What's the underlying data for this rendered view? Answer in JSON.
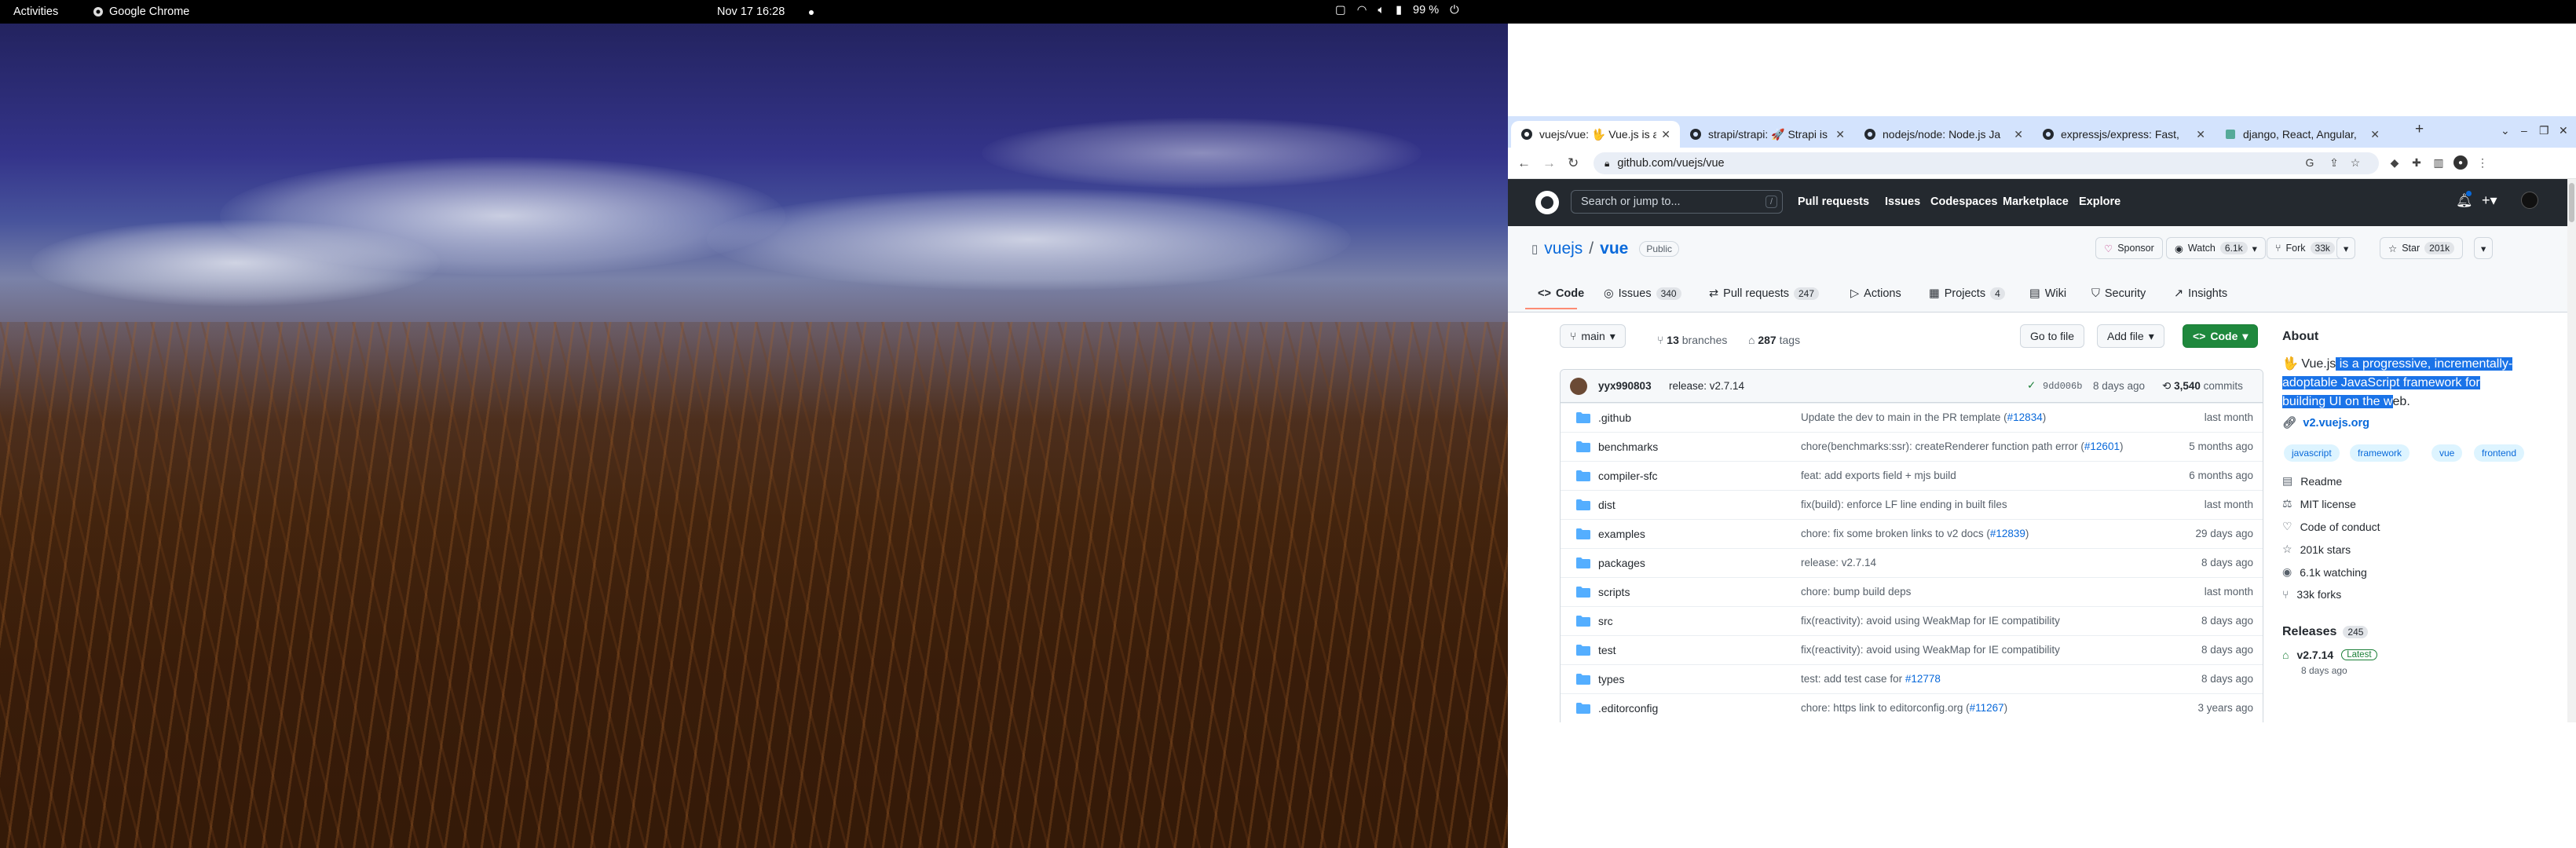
{
  "topbar": {
    "activities": "Activities",
    "app_name": "Google Chrome",
    "clock": "Nov 17  16:28",
    "battery": "99 %"
  },
  "browser": {
    "tabs": [
      {
        "title": "vuejs/vue: 🖖 Vue.js is a p"
      },
      {
        "title": "strapi/strapi: 🚀 Strapi is"
      },
      {
        "title": "nodejs/node: Node.js Ja"
      },
      {
        "title": "expressjs/express: Fast,"
      },
      {
        "title": "django, React, Angular,"
      }
    ],
    "url": "github.com/vuejs/vue"
  },
  "github": {
    "search_placeholder": "Search or jump to...",
    "search_key": "/",
    "nav": [
      "Pull requests",
      "Issues",
      "Codespaces",
      "Marketplace",
      "Explore"
    ],
    "repo": {
      "owner": "vuejs",
      "name": "vue",
      "visibility": "Public",
      "sponsor": "Sponsor",
      "watch_label": "Watch",
      "watch_count": "6.1k",
      "fork_label": "Fork",
      "fork_count": "33k",
      "star_label": "Star",
      "star_count": "201k"
    },
    "tabs": [
      {
        "label": "Code",
        "count": ""
      },
      {
        "label": "Issues",
        "count": "340"
      },
      {
        "label": "Pull requests",
        "count": "247"
      },
      {
        "label": "Actions",
        "count": ""
      },
      {
        "label": "Projects",
        "count": "4"
      },
      {
        "label": "Wiki",
        "count": ""
      },
      {
        "label": "Security",
        "count": ""
      },
      {
        "label": "Insights",
        "count": ""
      }
    ],
    "branch": "main",
    "branches_count": "13",
    "branches_label": "branches",
    "tags_count": "287",
    "tags_label": "tags",
    "go_to_file": "Go to file",
    "add_file": "Add file",
    "code_button": "Code",
    "latest_commit": {
      "author": "yyx990803",
      "message": "release: v2.7.14",
      "hash": "9dd006b",
      "age": "8 days ago",
      "commits_count": "3,540",
      "commits_label": "commits"
    },
    "files": [
      {
        "name": ".github",
        "msg": "Update the dev to main in the PR template (",
        "link": "#12834",
        "tail": ")",
        "age": "last month"
      },
      {
        "name": "benchmarks",
        "msg": "chore(benchmarks:ssr): createRenderer function path error (",
        "link": "#12601",
        "tail": ")",
        "age": "5 months ago"
      },
      {
        "name": "compiler-sfc",
        "msg": "feat: add exports field + mjs build",
        "link": "",
        "tail": "",
        "age": "6 months ago"
      },
      {
        "name": "dist",
        "msg": "fix(build): enforce LF line ending in built files",
        "link": "",
        "tail": "",
        "age": "last month"
      },
      {
        "name": "examples",
        "msg": "chore: fix some broken links to v2 docs (",
        "link": "#12839",
        "tail": ")",
        "age": "29 days ago"
      },
      {
        "name": "packages",
        "msg": "release: v2.7.14",
        "link": "",
        "tail": "",
        "age": "8 days ago"
      },
      {
        "name": "scripts",
        "msg": "chore: bump build deps",
        "link": "",
        "tail": "",
        "age": "last month"
      },
      {
        "name": "src",
        "msg": "fix(reactivity): avoid using WeakMap for IE compatibility",
        "link": "",
        "tail": "",
        "age": "8 days ago"
      },
      {
        "name": "test",
        "msg": "fix(reactivity): avoid using WeakMap for IE compatibility",
        "link": "",
        "tail": "",
        "age": "8 days ago"
      },
      {
        "name": "types",
        "msg": "test: add test case for ",
        "link": "#12778",
        "tail": "",
        "age": "8 days ago"
      },
      {
        "name": ".editorconfig",
        "msg": "chore: https link to editorconfig.org (",
        "link": "#11267",
        "tail": ")",
        "age": "3 years ago"
      }
    ],
    "about": {
      "heading": "About",
      "desc_plain": "🖖 Vue.js",
      "desc_selected": " is a progressive, incrementally-adoptable JavaScript framework for building UI on the w",
      "desc_rest": "eb.",
      "website": "v2.vuejs.org",
      "topics": [
        "javascript",
        "framework",
        "vue",
        "frontend"
      ],
      "readme": "Readme",
      "license": "MIT license",
      "conduct": "Code of conduct",
      "stars": "201k stars",
      "watching": "6.1k watching",
      "forks": "33k forks"
    },
    "releases": {
      "heading": "Releases",
      "count": "245",
      "latest_tag": "v2.7.14",
      "latest_badge": "Latest",
      "latest_age": "8 days ago"
    }
  },
  "colors": {
    "gh_header": "#24292f",
    "link": "#0969da",
    "selection": "#1a73e8",
    "green_button": "#1f883d",
    "folder": "#54aeff"
  }
}
